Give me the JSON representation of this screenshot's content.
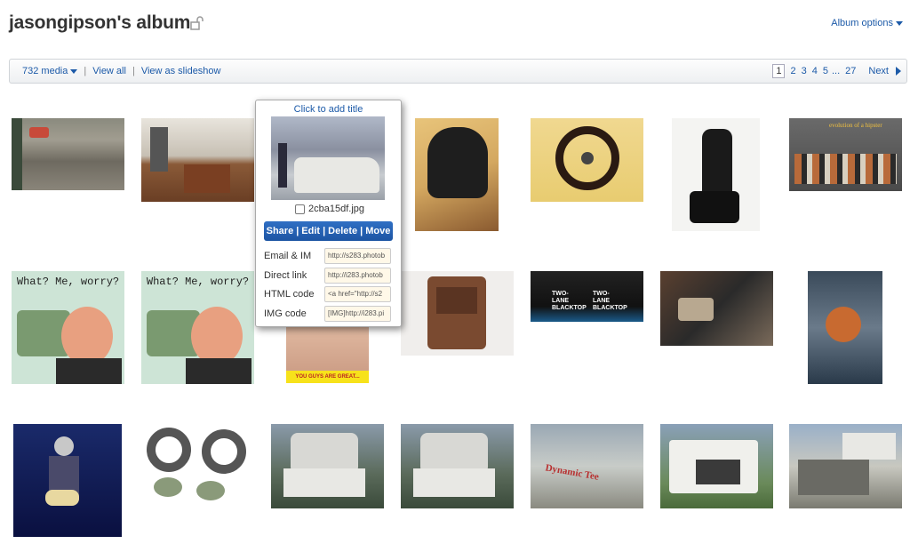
{
  "header": {
    "title": "jasongipson's album",
    "album_options": "Album options"
  },
  "toolbar": {
    "media_count": "732 media",
    "view_all": "View all",
    "view_slideshow": "View as slideshow"
  },
  "pager": {
    "pages": [
      "1",
      "2",
      "3",
      "4",
      "5",
      "...",
      "27"
    ],
    "current": "1",
    "next": "Next"
  },
  "popup": {
    "title_placeholder": "Click to add title",
    "filename": "2cba15df.jpg",
    "actions": [
      "Share",
      "Edit",
      "Delete",
      "Move"
    ],
    "links": [
      {
        "label": "Email & IM",
        "value": "http://s283.photob"
      },
      {
        "label": "Direct link",
        "value": "http://i283.photob"
      },
      {
        "label": "HTML code",
        "value": "<a href=\"http://s2"
      },
      {
        "label": "IMG code",
        "value": "[IMG]http://i283.pi"
      }
    ]
  },
  "thumbs": {
    "mad_caption": "What? Me, worry?",
    "two_lane_a": "TWO-LANE BLACKTOP",
    "two_lane_b": "TWO-LANE BLACKTOP",
    "great_caption": "YOU GUYS ARE GREAT...",
    "evolution_caption": "evolution of a hipster",
    "dynamic_caption": "Dynamic Tee"
  },
  "colors": {
    "link": "#1c5aa8",
    "action_button": "#2a66b8"
  }
}
